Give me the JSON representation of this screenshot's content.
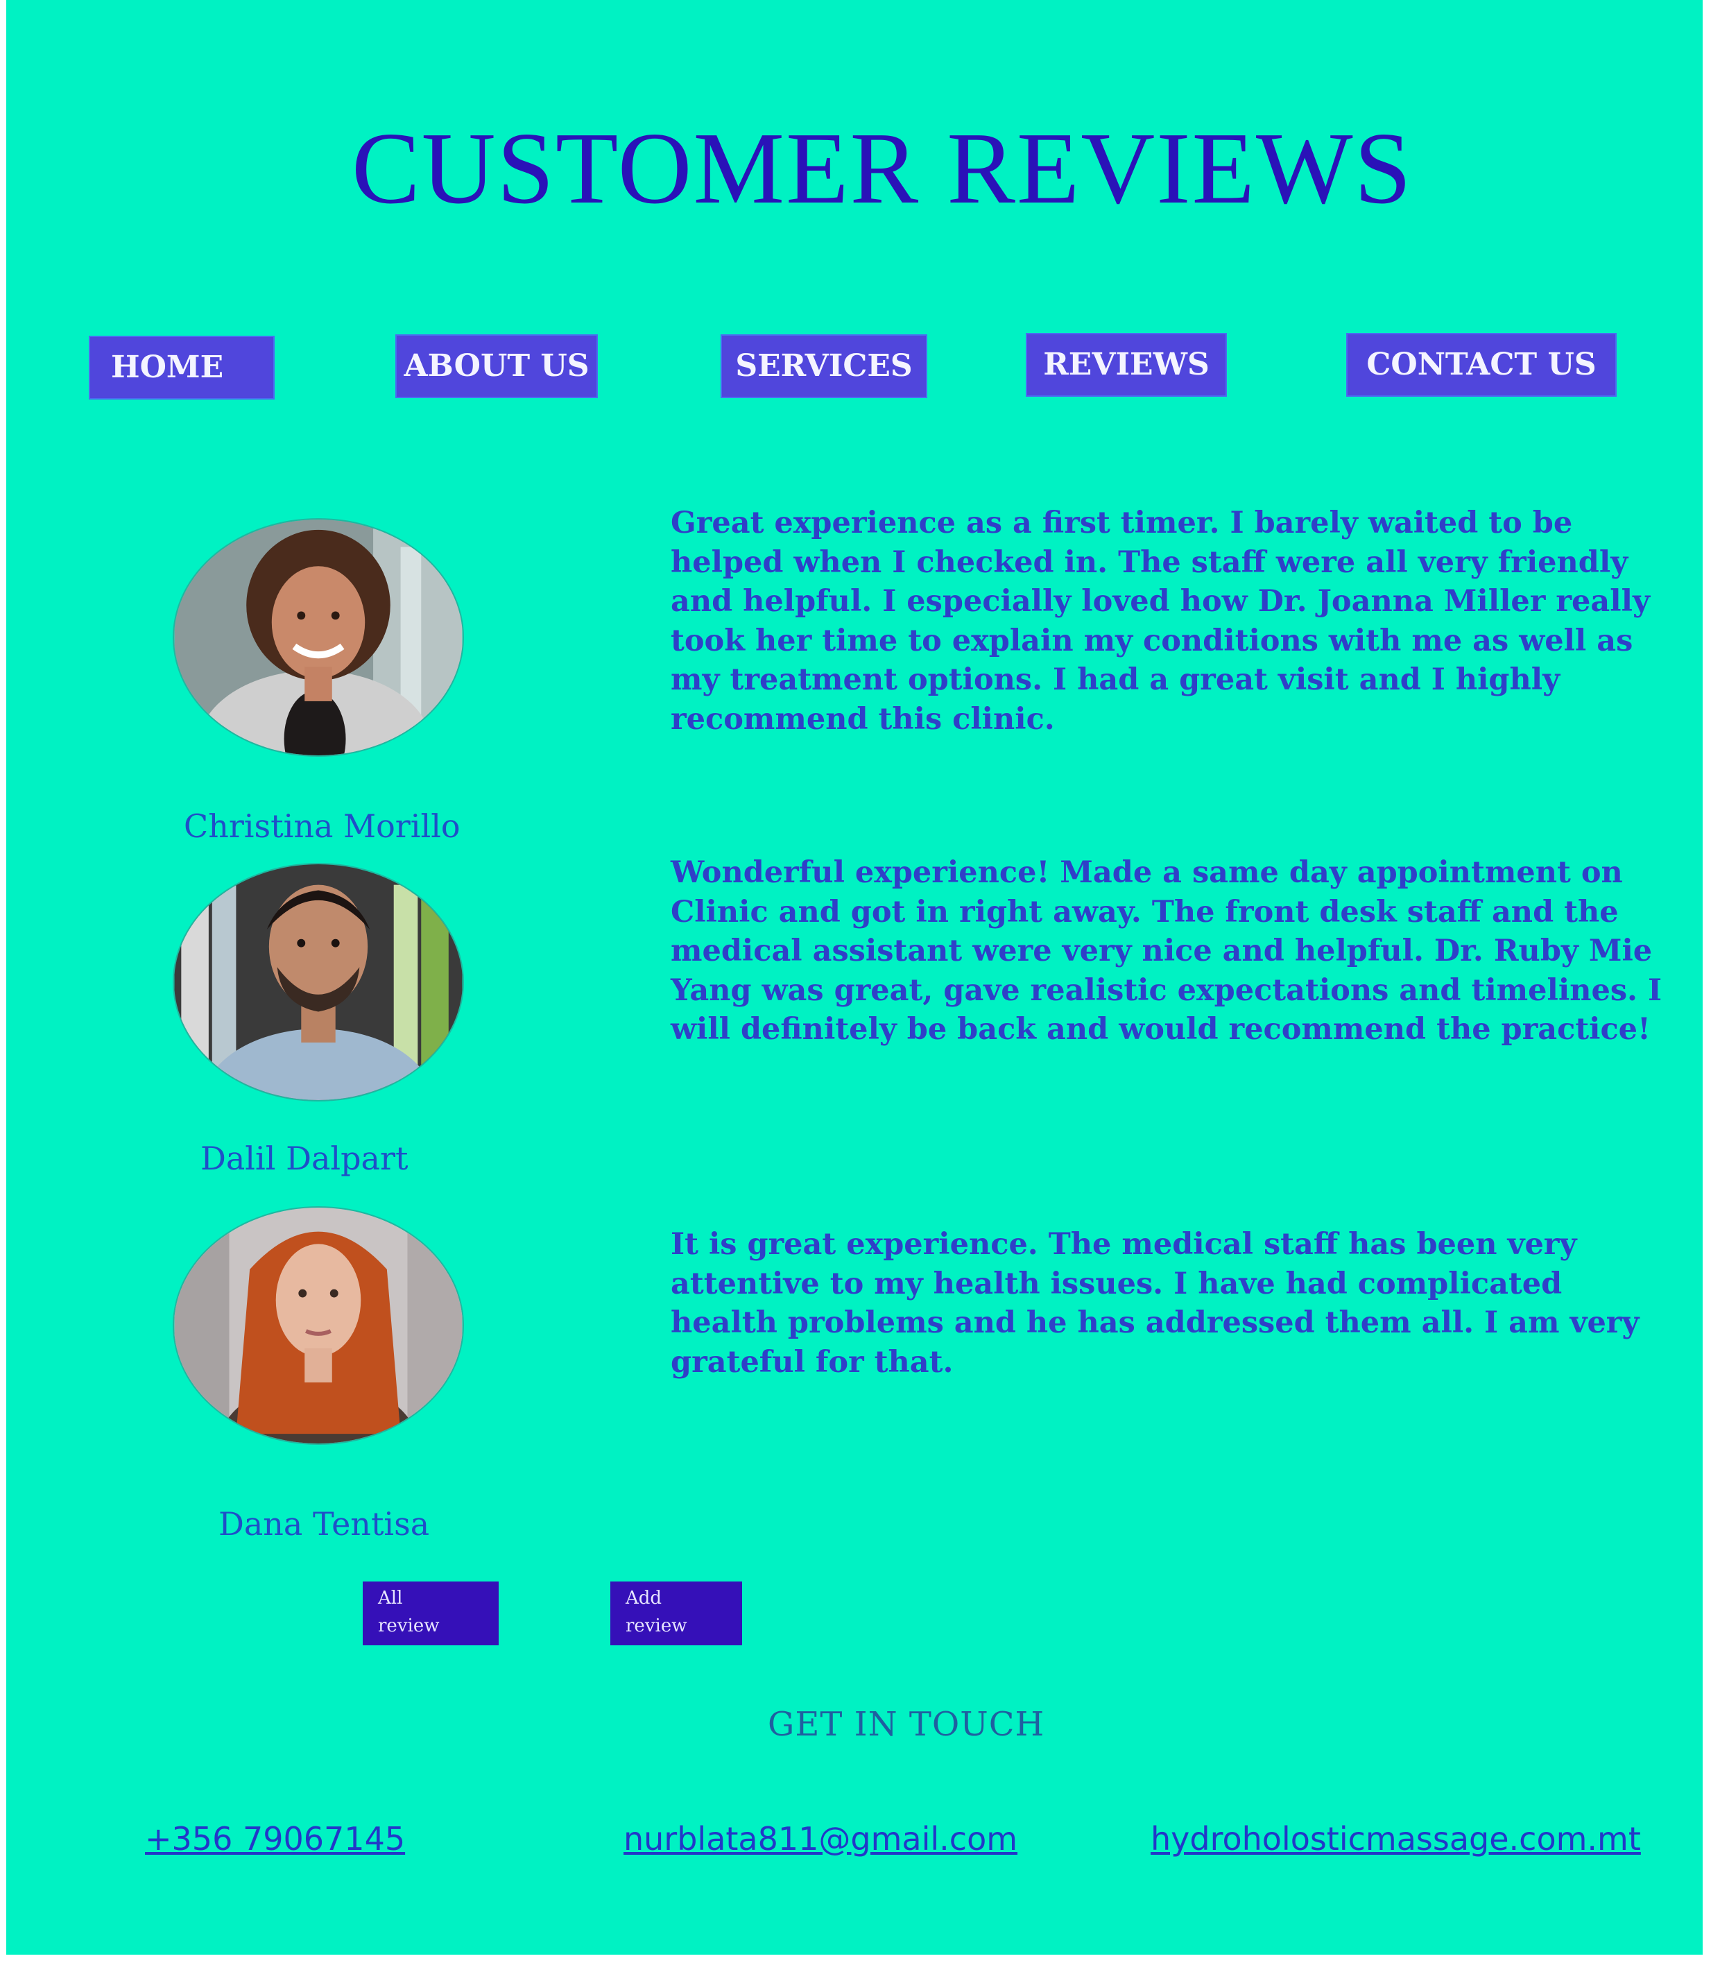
{
  "page": {
    "title": "CUSTOMER REVIEWS",
    "background_color": "#00f2c3",
    "accent_color": "#5046dc"
  },
  "nav": {
    "items": [
      {
        "label": "HOME"
      },
      {
        "label": "ABOUT US"
      },
      {
        "label": "SERVICES"
      },
      {
        "label": "REVIEWS"
      },
      {
        "label": "CONTACT US"
      }
    ]
  },
  "reviews": [
    {
      "name": "Christina Morillo",
      "avatar": "woman-curly-hair-photo",
      "text": "Great experience as a first timer. I barely waited to be helped when I checked in. The staff were all very friendly and helpful. I especially loved how Dr. Joanna Miller really took her time to explain my conditions with me as well as my treatment options. I had a great visit and I highly recommend this clinic."
    },
    {
      "name": "Dalil Dalpart",
      "avatar": "man-beard-photo",
      "text": "Wonderful experience! Made a same day appointment on Clinic and got in right away. The front desk staff and the medical assistant were very nice and helpful. Dr. Ruby Mie Yang was great, gave realistic expectations and timelines. I will definitely be back and would recommend the practice!"
    },
    {
      "name": "Dana Tentisa",
      "avatar": "woman-red-hair-photo",
      "text": "It is great experience. The medical staff has been very attentive to my health issues. I have had complicated health problems and he has addressed them all. I am very grateful for that."
    }
  ],
  "actions": {
    "all_review_line1": "All",
    "all_review_line2": "review",
    "add_review_line1": "Add",
    "add_review_line2": "review"
  },
  "footer": {
    "heading": "GET IN TOUCH",
    "phone": "+356 79067145",
    "email": "nurblata811@gmail.com",
    "website": "hydroholosticmassage.com.mt"
  }
}
